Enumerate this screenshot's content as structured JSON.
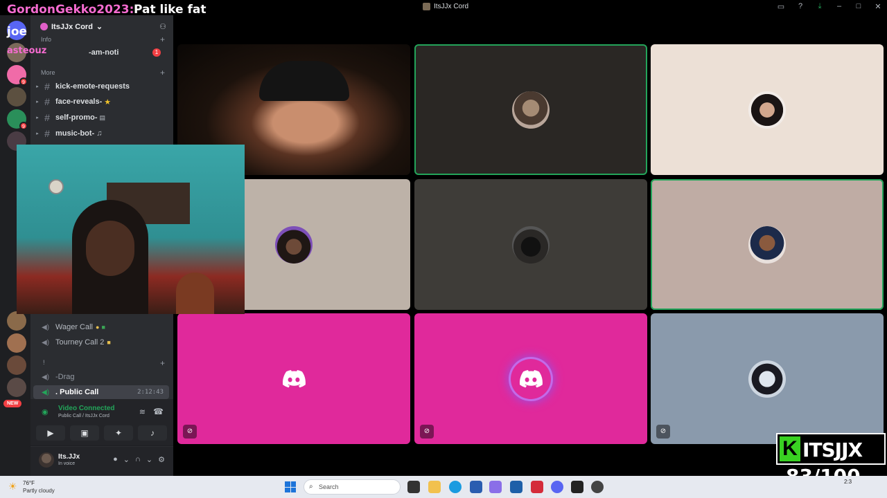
{
  "window": {
    "title": "ItsJJx Cord"
  },
  "overlay": {
    "chat_username": "GordonGekko2023",
    "chat_message": "Pat like fat",
    "label_joe": "joe",
    "label_asteouz": "asteouz",
    "brand_letter": "K",
    "brand_text": "ITSJJX",
    "counter": "83/100"
  },
  "server": {
    "name": "ItsJJx Cord"
  },
  "categories": {
    "info": "Info",
    "more": "More",
    "voice": "!"
  },
  "channels": {
    "stream_noti": "-am-noti",
    "stream_noti_mentions": "1",
    "text": [
      {
        "name": "kick-emote-requests"
      },
      {
        "name": "face-reveals-"
      },
      {
        "name": "self-promo-"
      },
      {
        "name": "music-bot-"
      }
    ],
    "voice": [
      {
        "name": "Wager Call"
      },
      {
        "name": "Tourney Call 2"
      },
      {
        "name": "-Drag"
      },
      {
        "name": ". Public Call"
      }
    ],
    "call_timer": "2:12:43"
  },
  "rail": {
    "new_badge": "NEW"
  },
  "voice_panel": {
    "title": "Video Connected",
    "subtitle": "Public Call / ItsJJx Cord"
  },
  "user": {
    "name": "Its.JJx",
    "status": "In voice"
  },
  "taskbar": {
    "weather_temp": "76°F",
    "weather_desc": "Partly cloudy",
    "search_label": "Search",
    "time": "2:3"
  },
  "colors": {
    "accent_green": "#23a55a",
    "discord_pink": "#e0299b",
    "overlay_pink": "#f56bd0",
    "brand_green": "#39d122"
  },
  "icons": [
    "search-icon",
    "discord-logo-icon",
    "mic-muted-icon",
    "headphones-icon",
    "gear-icon",
    "signal-icon",
    "disconnect-icon",
    "camera-off-icon",
    "screen-share-icon",
    "activity-icon",
    "soundboard-icon",
    "hash-icon",
    "speaker-icon",
    "invite-icon"
  ]
}
